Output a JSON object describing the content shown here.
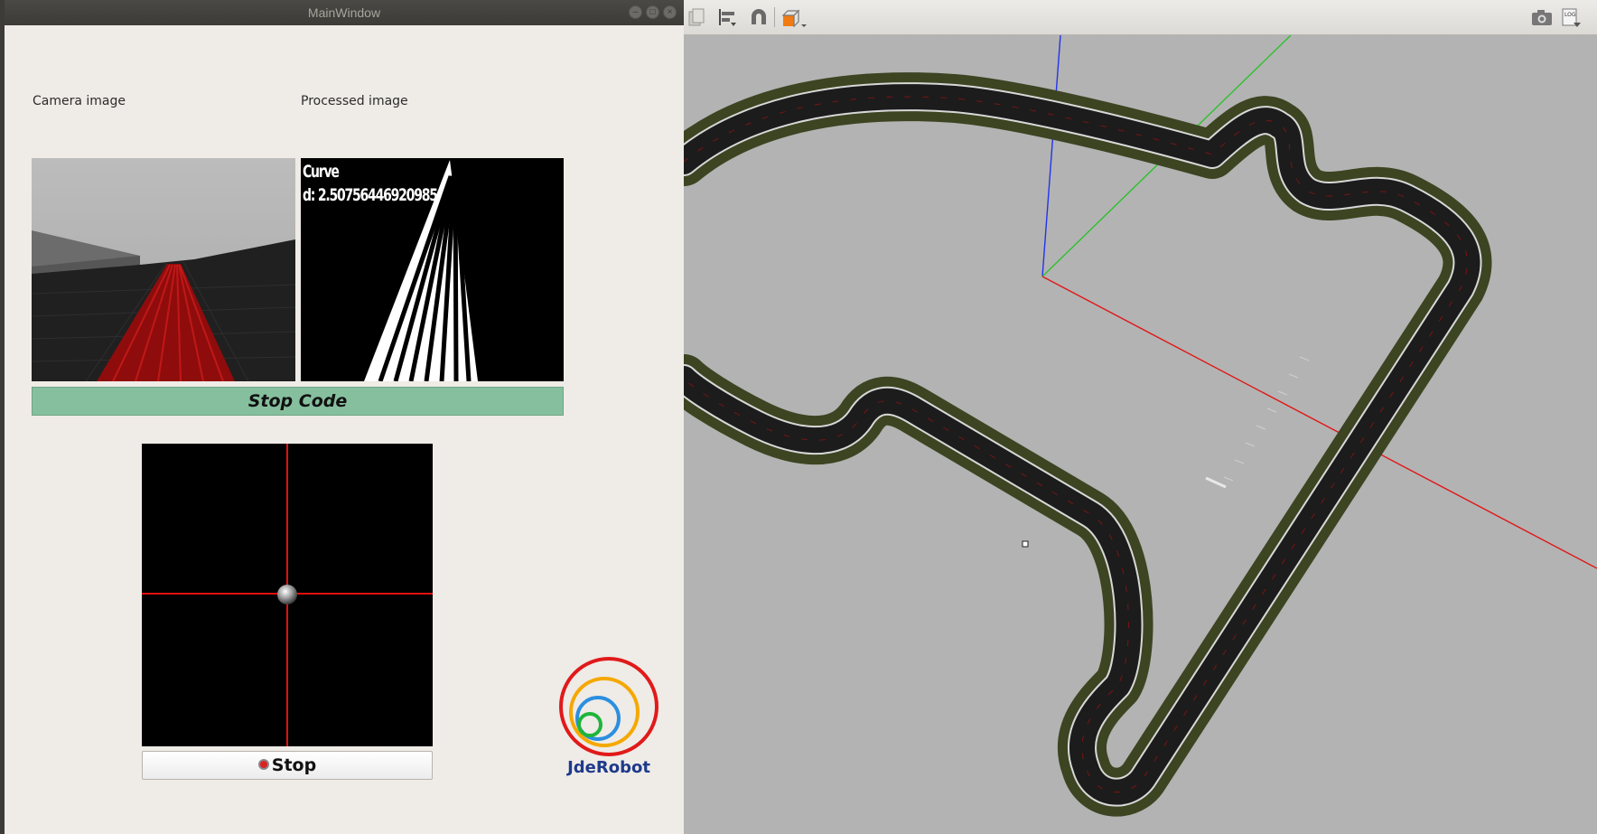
{
  "window": {
    "title": "MainWindow",
    "controls": [
      "minimize-icon",
      "maximize-icon",
      "close-icon"
    ]
  },
  "labels": {
    "camera": "Camera image",
    "processed": "Processed image"
  },
  "processed_overlay": {
    "line1": "Curve",
    "line2": "d: 2.50756446920985"
  },
  "buttons": {
    "stop_code": "Stop Code",
    "stop": "Stop"
  },
  "logo": {
    "text": "JdeRobot"
  },
  "viewer_toolbar": {
    "icons": [
      "copy-icon",
      "align-icon",
      "magnet-icon",
      "view-angle-icon",
      "screenshot-icon",
      "log-icon"
    ]
  },
  "colors": {
    "stop_code_bg": "#86bf9e",
    "track_surface": "#1c1c1c",
    "track_border": "#3c4422",
    "ground": "#b2b2b2"
  }
}
